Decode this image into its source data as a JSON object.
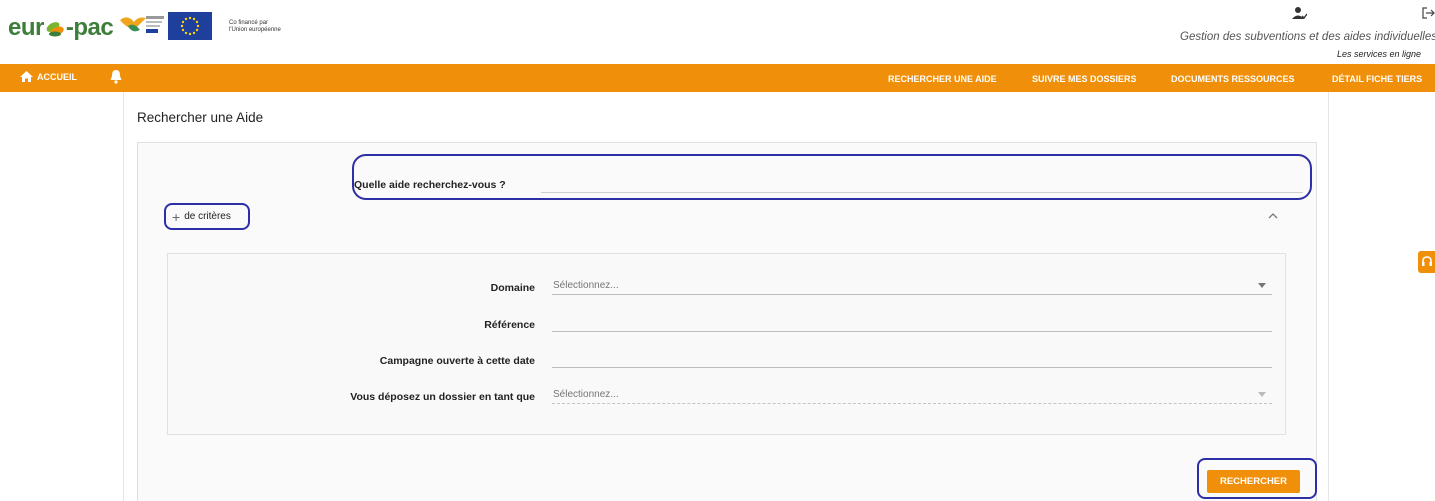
{
  "header": {
    "logo_text": {
      "part1": "eur",
      "part2": "-pac"
    },
    "cofinance_line1": "Co financé par",
    "cofinance_line2": "l'Union européenne",
    "subtitle": "Gestion des subventions et des aides individuelles",
    "services": "Les services en ligne",
    "icons": [
      "user-icon",
      "logout-icon",
      "eu-flag",
      "partner-logo"
    ]
  },
  "nav": {
    "home_label": "ACCUEIL",
    "links": [
      "RECHERCHER UNE AIDE",
      "SUIVRE MES DOSSIERS",
      "DOCUMENTS RESSOURCES",
      "DÉTAIL FICHE TIERS"
    ],
    "icons": [
      "home-icon",
      "bell-icon"
    ]
  },
  "page": {
    "title": "Rechercher une Aide",
    "question_label": "Quelle aide recherchez-vous ?",
    "question_value": "",
    "more_criteria_label": "de critères",
    "fields": [
      {
        "label": "Domaine",
        "placeholder": "Sélectionnez...",
        "type": "select"
      },
      {
        "label": "Référence",
        "placeholder": "",
        "type": "text"
      },
      {
        "label": "Campagne ouverte à cette date",
        "placeholder": "",
        "type": "date"
      },
      {
        "label": "Vous déposez un dossier en tant que",
        "placeholder": "Sélectionnez...",
        "type": "select"
      }
    ],
    "search_button": "RECHERCHER"
  },
  "colors": {
    "accent": "#f0900a",
    "highlight": "#2e2ea7",
    "logo_green": "#3d7f3a"
  }
}
